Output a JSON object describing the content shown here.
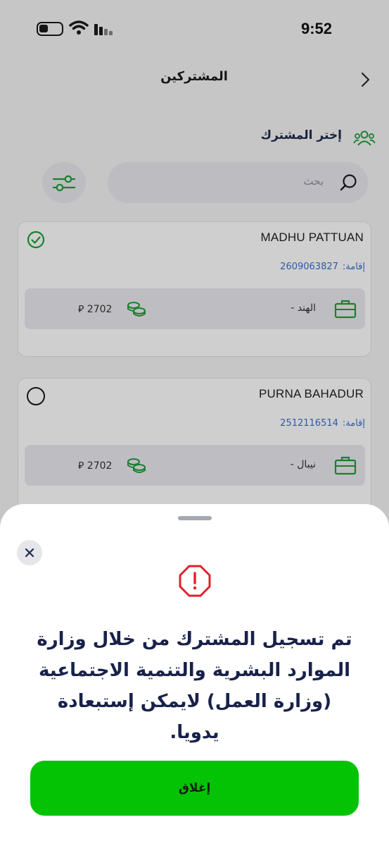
{
  "status_bar": {
    "time": "9:52"
  },
  "header": {
    "title": "المشتركين",
    "back_icon": "chevron-right-icon"
  },
  "section": {
    "title": "إختر المشترك",
    "icon": "users-icon"
  },
  "search": {
    "placeholder": "بحث",
    "icon": "search-icon"
  },
  "filter": {
    "icon": "sliders-icon"
  },
  "subscribers": [
    {
      "name": "MADHU PATTUAN",
      "id_label": "إقامة:",
      "id_number": "2609063827",
      "country": "الهند -",
      "salary": "2702",
      "selected": true
    },
    {
      "name": "PURNA BAHADUR",
      "id_label": "إقامة:",
      "id_number": "2512116514",
      "country": "نيبال -",
      "salary": "2702",
      "selected": false
    }
  ],
  "sheet": {
    "message": "تم تسجيل المشترك من خلال وزارة الموارد البشرية والتنمية الاجتماعية (وزارة العمل) لايمكن إستبعادة يدويا.",
    "button_label": "إغلاق",
    "alert_icon": "alert-octagon-icon",
    "close_icon": "close-icon"
  },
  "colors": {
    "accent_green": "#04c304",
    "icon_green": "#1f9e3a",
    "alert_red": "#e0202a",
    "link_blue": "#3a6fd0"
  }
}
